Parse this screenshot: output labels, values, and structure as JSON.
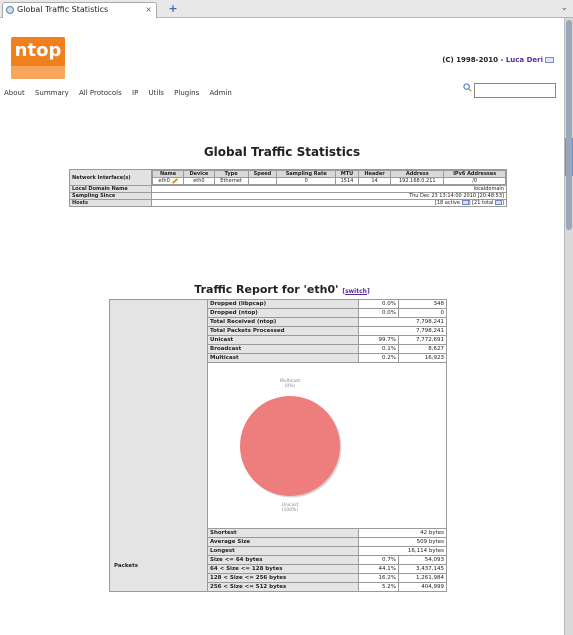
{
  "browser": {
    "tab_title": "Global Traffic Statistics",
    "new_tab": "+",
    "tab_list": "⌄"
  },
  "header": {
    "logo_text": "ntop",
    "copyright": "(C) 1998-2010 - ",
    "author": "Luca Deri"
  },
  "menu": [
    "About",
    "Summary",
    "All Protocols",
    "IP",
    "Utils",
    "Plugins",
    "Admin"
  ],
  "search": {
    "placeholder": ""
  },
  "page_title": "Global Traffic Statistics",
  "summary": {
    "interface_label": "Network Interface(s)",
    "columns": [
      "Name",
      "Device",
      "Type",
      "Speed",
      "Sampling Rate",
      "MTU",
      "Header",
      "Address",
      "IPv6 Addresses"
    ],
    "row": [
      "eth0",
      "eth0",
      "Ethernet",
      "",
      "0",
      "1514",
      "14",
      "192.168.0.211",
      "/0"
    ],
    "domain_label": "Local Domain Name",
    "domain_value": "localdomain",
    "since_label": "Sampling Since",
    "since_value": "Thu Dec 23 13:14:00 2010 [20:48:53]",
    "hosts_label": "Hosts",
    "hosts_active": "[18 active",
    "hosts_total": "] [21 total",
    "hosts_end": "]"
  },
  "report": {
    "title": "Traffic Report for 'eth0' ",
    "switch_open": "[",
    "switch_label": "switch",
    "switch_close": "]",
    "packets_label": "Packets",
    "rows": [
      {
        "label": "Dropped (libpcap)",
        "pct": "0.0%",
        "value": "348"
      },
      {
        "label": "Dropped (ntop)",
        "pct": "0.0%",
        "value": "0"
      },
      {
        "label": "Total Received (ntop)",
        "pct": "",
        "value": "7,798,241"
      },
      {
        "label": "Total Packets Processed",
        "pct": "",
        "value": "7,798,241"
      },
      {
        "label": "Unicast",
        "pct": "99.7%",
        "value": "7,772,691"
      },
      {
        "label": "Broadcast",
        "pct": "0.1%",
        "value": "8,627"
      },
      {
        "label": "Multicast",
        "pct": "0.2%",
        "value": "16,923"
      }
    ],
    "size_rows": [
      {
        "label": "Shortest",
        "pct": "",
        "value": "42 bytes"
      },
      {
        "label": "Average Size",
        "pct": "",
        "value": "509 bytes"
      },
      {
        "label": "Longest",
        "pct": "",
        "value": "16,114 bytes"
      },
      {
        "label": "Size <= 64 bytes",
        "pct": "0.7%",
        "value": "54,093"
      },
      {
        "label": "64 < Size <= 128 bytes",
        "pct": "44.1%",
        "value": "3,437,145"
      },
      {
        "label": "128 < Size <= 256 bytes",
        "pct": "16.2%",
        "value": "1,261,984"
      },
      {
        "label": "256 < Size <= 512 bytes",
        "pct": "5.2%",
        "value": "404,999"
      }
    ]
  },
  "chart_data": {
    "type": "pie",
    "categories": [
      "Multicast",
      "Unicast"
    ],
    "values": [
      0,
      100
    ],
    "labels": [
      "Multicast\n(0%)",
      "Unicast\n(100%)"
    ],
    "colors": [
      "#e06666",
      "#ee7d7d"
    ]
  }
}
